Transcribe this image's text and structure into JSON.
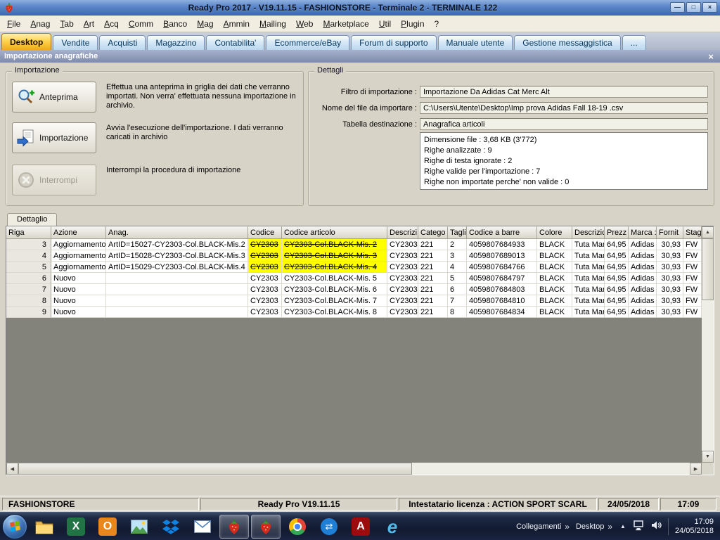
{
  "window": {
    "title": "Ready Pro 2017 - V19.11.15 - FASHIONSTORE - Terminale 2 - TERMINALE 122"
  },
  "icons": {
    "close": "×",
    "minimize": "—",
    "maximize": "□",
    "up": "▲",
    "down": "▼",
    "left": "◀",
    "right": "▶",
    "chevrons": "»",
    "hidden_tray": "▲"
  },
  "menu": {
    "items": [
      "File",
      "Anag",
      "Tab",
      "Art",
      "Acq",
      "Comm",
      "Banco",
      "Mag",
      "Ammin",
      "Mailing",
      "Web",
      "Marketplace",
      "Util",
      "Plugin",
      "?"
    ]
  },
  "tabs": {
    "items": [
      {
        "label": "Desktop",
        "active": true
      },
      {
        "label": "Vendite",
        "active": false
      },
      {
        "label": "Acquisti",
        "active": false
      },
      {
        "label": "Magazzino",
        "active": false
      },
      {
        "label": "Contabilita'",
        "active": false
      },
      {
        "label": "Ecommerce/eBay",
        "active": false
      },
      {
        "label": "Forum di supporto",
        "active": false
      },
      {
        "label": "Manuale utente",
        "active": false
      },
      {
        "label": "Gestione messaggistica",
        "active": false
      },
      {
        "label": "...",
        "active": false
      }
    ]
  },
  "panel": {
    "title": "Importazione anagrafiche"
  },
  "importazione": {
    "group_title": "Importazione",
    "buttons": [
      {
        "label": "Anteprima",
        "description": "Effettua una anteprima in griglia dei dati che verranno importati. Non verra' effettuata nessuna importazione in archivio.",
        "disabled": false
      },
      {
        "label": "Importazione",
        "description": "Avvia l'esecuzione dell'importazione. I dati verranno caricati in archivio",
        "disabled": false
      },
      {
        "label": "Interrompi",
        "description": "Interrompi la procedura di importazione",
        "disabled": true
      }
    ]
  },
  "dettagli": {
    "group_title": "Dettagli",
    "fields": [
      {
        "label": "Filtro di importazione :",
        "value": "Importazione Da Adidas Cat Merc Alt"
      },
      {
        "label": "Nome del file da importare :",
        "value": "C:\\Users\\Utente\\Desktop\\Imp prova Adidas Fall 18-19 .csv"
      },
      {
        "label": "Tabella destinazione :",
        "value": "Anagrafica articoli"
      }
    ],
    "info_lines": [
      "Dimensione file : 3,68 KB (3'772)",
      "Righe analizzate : 9",
      "Righe di testa ignorate : 2",
      "Righe valide per l'importazione : 7",
      "Righe non importate perche' non valide : 0"
    ]
  },
  "detail_tab": "Dettaglio",
  "grid": {
    "columns": [
      "Riga",
      "Azione",
      "Anag.",
      "Codice",
      "Codice articolo",
      "Descrizi",
      "Catego",
      "Tagli",
      "Codice a barre",
      "Colore",
      "Descrizion",
      "Prezz",
      "Marca :",
      "Fornit",
      "Stag"
    ],
    "rows": [
      {
        "modified": true,
        "cells": [
          "3",
          "Aggiornamento",
          "ArtID=15027-CY2303-Col.BLACK-Mis.2 -",
          "CY2303",
          "CY2303-Col.BLACK-Mis. 2",
          "CY2303",
          "221",
          "2",
          "4059807684933",
          "BLACK",
          "Tuta Man",
          "64,95",
          "Adidas",
          "30,93",
          "FW"
        ]
      },
      {
        "modified": true,
        "cells": [
          "4",
          "Aggiornamento",
          "ArtID=15028-CY2303-Col.BLACK-Mis.3 -",
          "CY2303",
          "CY2303-Col.BLACK-Mis. 3",
          "CY2303",
          "221",
          "3",
          "4059807689013",
          "BLACK",
          "Tuta Man",
          "64,95",
          "Adidas",
          "30,93",
          "FW"
        ]
      },
      {
        "modified": true,
        "cells": [
          "5",
          "Aggiornamento",
          "ArtID=15029-CY2303-Col.BLACK-Mis.4 -",
          "CY2303",
          "CY2303-Col.BLACK-Mis. 4",
          "CY2303",
          "221",
          "4",
          "4059807684766",
          "BLACK",
          "Tuta Man",
          "64,95",
          "Adidas",
          "30,93",
          "FW"
        ]
      },
      {
        "modified": false,
        "cells": [
          "6",
          "Nuovo",
          "",
          "CY2303",
          "CY2303-Col.BLACK-Mis. 5",
          "CY2303",
          "221",
          "5",
          "4059807684797",
          "BLACK",
          "Tuta Man",
          "64,95",
          "Adidas",
          "30,93",
          "FW"
        ]
      },
      {
        "modified": false,
        "cells": [
          "7",
          "Nuovo",
          "",
          "CY2303",
          "CY2303-Col.BLACK-Mis. 6",
          "CY2303",
          "221",
          "6",
          "4059807684803",
          "BLACK",
          "Tuta Man",
          "64,95",
          "Adidas",
          "30,93",
          "FW"
        ]
      },
      {
        "modified": false,
        "cells": [
          "8",
          "Nuovo",
          "",
          "CY2303",
          "CY2303-Col.BLACK-Mis. 7",
          "CY2303",
          "221",
          "7",
          "4059807684810",
          "BLACK",
          "Tuta Man",
          "64,95",
          "Adidas",
          "30,93",
          "FW"
        ]
      },
      {
        "modified": false,
        "cells": [
          "9",
          "Nuovo",
          "",
          "CY2303",
          "CY2303-Col.BLACK-Mis. 8",
          "CY2303",
          "221",
          "8",
          "4059807684834",
          "BLACK",
          "Tuta Man",
          "64,95",
          "Adidas",
          "30,93",
          "FW"
        ]
      }
    ]
  },
  "statusbar": {
    "panels": [
      "FASHIONSTORE",
      "Ready Pro V19.11.15",
      "Intestatario licenza : ACTION SPORT SCARL",
      "24/05/2018",
      "17:09"
    ]
  },
  "taskbar": {
    "toolbar1": "Collegamenti",
    "toolbar2": "Desktop",
    "clock_time": "17:09",
    "clock_date": "24/05/2018",
    "icons": [
      "start",
      "explorer",
      "excel",
      "outlook",
      "photo-viewer",
      "dropbox",
      "mail",
      "readypro",
      "readypro-active",
      "chrome",
      "sync",
      "adobe-reader",
      "internet-explorer"
    ]
  }
}
